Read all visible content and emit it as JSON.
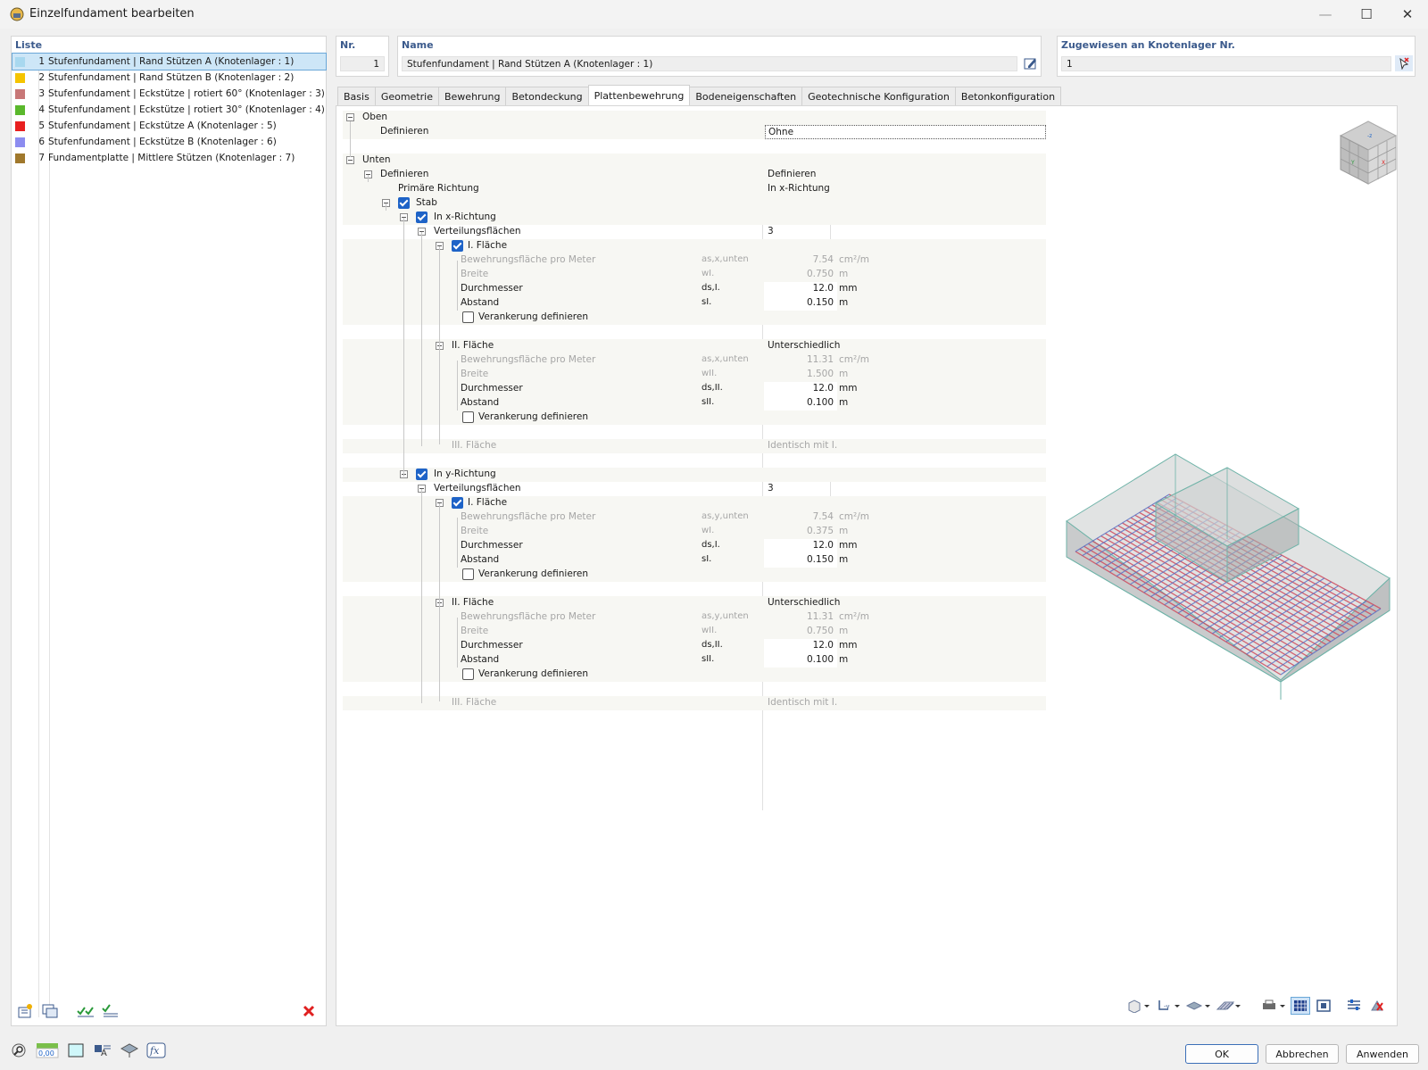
{
  "window": {
    "title": "Einzelfundament bearbeiten",
    "minimize": "—",
    "maximize": "☐",
    "close": "✕"
  },
  "list": {
    "header": "Liste",
    "items": [
      {
        "num": "1",
        "label": "Stufenfundament | Rand Stützen A (Knotenlager : 1)",
        "color": "#a8d8ef"
      },
      {
        "num": "2",
        "label": "Stufenfundament | Rand Stützen B (Knotenlager : 2)",
        "color": "#f5c400"
      },
      {
        "num": "3",
        "label": "Stufenfundament | Eckstütze | rotiert 60° (Knotenlager : 3)",
        "color": "#c87878"
      },
      {
        "num": "4",
        "label": "Stufenfundament | Eckstütze | rotiert 30° (Knotenlager : 4)",
        "color": "#5ab82c"
      },
      {
        "num": "5",
        "label": "Stufenfundament | Eckstütze A (Knotenlager : 5)",
        "color": "#e81f1f"
      },
      {
        "num": "6",
        "label": "Stufenfundament | Eckstütze B (Knotenlager : 6)",
        "color": "#8c8cf0"
      },
      {
        "num": "7",
        "label": "Fundamentplatte | Mittlere Stützen (Knotenlager : 7)",
        "color": "#a0782c"
      }
    ]
  },
  "header": {
    "nr_label": "Nr.",
    "nr_value": "1",
    "name_label": "Name",
    "name_value": "Stufenfundament | Rand Stützen A (Knotenlager : 1)",
    "assigned_label": "Zugewiesen an Knotenlager Nr.",
    "assigned_value": "1"
  },
  "tabs": [
    "Basis",
    "Geometrie",
    "Bewehrung",
    "Betondeckung",
    "Plattenbewehrung",
    "Bodeneigenschaften",
    "Geotechnische Konfiguration",
    "Betonkonfiguration"
  ],
  "tree": {
    "oben": "Oben",
    "definieren": "Definieren",
    "ohne": "Ohne",
    "unten": "Unten",
    "definieren_value": "Definieren",
    "primary_dir": "Primäre Richtung",
    "primary_dir_value": "In x-Richtung",
    "stab": "Stab",
    "x_dir": "In x-Richtung",
    "y_dir": "In y-Richtung",
    "verteilung": "Verteilungsflächen",
    "verteilung_value": "3",
    "flaeche1": "I. Fläche",
    "flaeche2": "II. Fläche",
    "flaeche3": "III. Fläche",
    "unterschiedlich": "Unterschiedlich",
    "identisch": "Identisch mit I.",
    "bew_flaeche": "Bewehrungsfläche pro Meter",
    "breite": "Breite",
    "durchmesser": "Durchmesser",
    "abstand": "Abstand",
    "verankerung": "Verankerung definieren",
    "sym_asx": "as,x,unten",
    "sym_asy": "as,y,unten",
    "sym_wI": "wI.",
    "sym_wII": "wII.",
    "sym_dsI": "ds,I.",
    "sym_dsII": "ds,II.",
    "sym_sI": "sI.",
    "sym_sII": "sII.",
    "unit_cm2m": "cm²/m",
    "unit_m": "m",
    "unit_mm": "mm",
    "x": {
      "f1": {
        "as": "7.54",
        "w": "0.750",
        "ds": "12.0",
        "s": "0.150"
      },
      "f2": {
        "as": "11.31",
        "w": "1.500",
        "ds": "12.0",
        "s": "0.100"
      }
    },
    "y": {
      "f1": {
        "as": "7.54",
        "w": "0.375",
        "ds": "12.0",
        "s": "0.150"
      },
      "f2": {
        "as": "11.31",
        "w": "0.750",
        "ds": "12.0",
        "s": "0.100"
      }
    }
  },
  "buttons": {
    "ok": "OK",
    "cancel": "Abbrechen",
    "apply": "Anwenden"
  },
  "bottom_tools": {
    "units": "0,00"
  },
  "colors": {
    "accent": "#1e63c7",
    "header_text": "#3b5a8c",
    "rebar_red": "#d04a5c",
    "rebar_blue": "#5b6fc2"
  }
}
